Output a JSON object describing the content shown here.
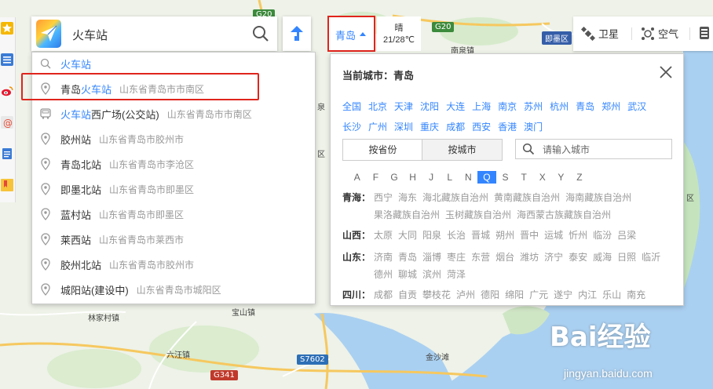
{
  "map": {
    "road_labels": [
      "G20",
      "G20",
      "S7602",
      "G341"
    ],
    "place_labels": [
      "南泉镇",
      "即墨区",
      "林家村镇",
      "宝山镇",
      "六汪镇",
      "金沙滩",
      "区",
      "泉",
      "区"
    ]
  },
  "left_rail": {
    "icons": [
      "star-icon",
      "list-icon",
      "weibo-icon",
      "email-icon",
      "document-icon",
      "bookmark-icon"
    ]
  },
  "search": {
    "value": "火车站",
    "button_icon": "search-icon"
  },
  "suggestions": [
    {
      "icon": "search-icon",
      "highlight": "火车站",
      "rest": "",
      "address": ""
    },
    {
      "icon": "pin-icon",
      "prefix": "青岛",
      "highlight": "火车站",
      "rest": "",
      "address": "山东省青岛市市南区"
    },
    {
      "icon": "bus-icon",
      "prefix": "",
      "highlight": "火车站",
      "rest": "西广场(公交站)",
      "address": "山东省青岛市市南区"
    },
    {
      "icon": "pin-icon",
      "prefix": "胶州站",
      "highlight": "",
      "rest": "",
      "address": "山东省青岛市胶州市"
    },
    {
      "icon": "pin-icon",
      "prefix": "青岛北站",
      "highlight": "",
      "rest": "",
      "address": "山东省青岛市李沧区"
    },
    {
      "icon": "pin-icon",
      "prefix": "即墨北站",
      "highlight": "",
      "rest": "",
      "address": "山东省青岛市即墨区"
    },
    {
      "icon": "pin-icon",
      "prefix": "蓝村站",
      "highlight": "",
      "rest": "",
      "address": "山东省青岛市即墨区"
    },
    {
      "icon": "pin-icon",
      "prefix": "莱西站",
      "highlight": "",
      "rest": "",
      "address": "山东省青岛市莱西市"
    },
    {
      "icon": "pin-icon",
      "prefix": "胶州北站",
      "highlight": "",
      "rest": "",
      "address": "山东省青岛市胶州市"
    },
    {
      "icon": "pin-icon",
      "prefix": "城阳站(建设中)",
      "highlight": "",
      "rest": "",
      "address": "山东省青岛市城阳区"
    }
  ],
  "city_button": {
    "label": "青岛"
  },
  "weather": {
    "condition": "晴",
    "temp": "21/28℃"
  },
  "toolbar": {
    "satellite": "卫星",
    "air": "空气"
  },
  "city_panel": {
    "title": "当前城市：青岛",
    "hot_cities": [
      "全国",
      "北京",
      "天津",
      "沈阳",
      "大连",
      "上海",
      "南京",
      "苏州",
      "杭州",
      "青岛",
      "郑州",
      "武汉",
      "长沙",
      "广州",
      "深圳",
      "重庆",
      "成都",
      "西安",
      "香港",
      "澳门"
    ],
    "tabs": [
      "按省份",
      "按城市"
    ],
    "active_tab": "按省份",
    "city_search_placeholder": "请输入城市",
    "letters": [
      "A",
      "F",
      "G",
      "H",
      "J",
      "L",
      "N",
      "Q",
      "S",
      "T",
      "X",
      "Y",
      "Z"
    ],
    "active_letter": "Q",
    "provinces": [
      {
        "name": "青海：",
        "cities": [
          "西宁",
          "海东",
          "海北藏族自治州",
          "黄南藏族自治州",
          "海南藏族自治州",
          "果洛藏族自治州",
          "玉树藏族自治州",
          "海西蒙古族藏族自治州"
        ]
      },
      {
        "name": "山西：",
        "cities": [
          "太原",
          "大同",
          "阳泉",
          "长治",
          "晋城",
          "朔州",
          "晋中",
          "运城",
          "忻州",
          "临汾",
          "吕梁"
        ]
      },
      {
        "name": "山东：",
        "cities": [
          "济南",
          "青岛",
          "淄博",
          "枣庄",
          "东营",
          "烟台",
          "潍坊",
          "济宁",
          "泰安",
          "威海",
          "日照",
          "临沂",
          "德州",
          "聊城",
          "滨州",
          "菏泽"
        ]
      },
      {
        "name": "四川：",
        "cities": [
          "成都",
          "自贡",
          "攀枝花",
          "泸州",
          "德阳",
          "绵阳",
          "广元",
          "遂宁",
          "内江",
          "乐山",
          "南充"
        ]
      }
    ]
  },
  "watermark": {
    "brand": "Bai经验",
    "url": "jingyan.baidu.com"
  }
}
